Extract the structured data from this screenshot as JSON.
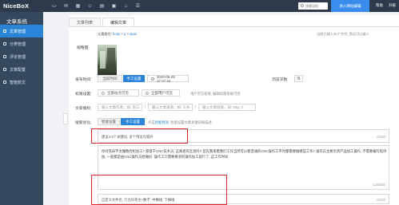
{
  "header": {
    "brand": "NiceBoX",
    "icons": [
      "monitor-icon",
      "chat-icon",
      "grid-icon",
      "user-icon",
      "document-icon",
      "window-icon",
      "home-icon",
      "list-icon"
    ],
    "quick_nav": "快捷导航",
    "editor_button": "进入网站编辑",
    "help": "帮助",
    "upgrade": "升级"
  },
  "sidebar": {
    "title": "文章系统",
    "items": [
      {
        "label": "文章管理",
        "active": true
      },
      {
        "label": "分类管理",
        "active": false
      },
      {
        "label": "评论管理",
        "active": false
      },
      {
        "label": "文章配置",
        "active": false
      },
      {
        "label": "智能软文",
        "active": false
      }
    ]
  },
  "tabs": [
    "文章列表",
    "编辑文章"
  ],
  "path": {
    "prefix": "元素路径: ",
    "body": "body",
    "sep1": " > ",
    "p": "p",
    "sep2": " > ",
    "span": "span",
    "hint": "当前已输入45个字符, 您还可以输入"
  },
  "form": {
    "thumb_label": "缩略图:",
    "publish_label": "发布时间:",
    "publish_current": "当前时间",
    "publish_manual": "手工设置",
    "publish_value": "2020-05-08 17:37:44",
    "browse_label": "浏览次数:",
    "browse_value": "9",
    "perm_label": "权限设置:",
    "perm_all": "全部站点可见",
    "perm_user": "全部用户可见",
    "perm_hint": "用户可见权限, 编辑权限系统可控",
    "source_label": "文章版权:",
    "source_author": "输入文章作者。如: 张三",
    "source_from": "输入文章来源。如: 头条",
    "source_link": "输入文章链接。如: http: //",
    "seo_label": "搜索优化:",
    "seo_smart": "智能设置",
    "seo_manual": "手工设置",
    "seo_hint_prefix": "点击",
    "seo_hint_link": "智能预测",
    "seo_hint_suffix": ", 智能设置文章关键词和描述"
  },
  "keywords": {
    "placeholder": "建议3-5个关键词, 多个用逗号隔开",
    "count": "0/100"
  },
  "description": {
    "text": "你对铣床不太懂数控机加工? 愿意干CNC技术员, 这两者有区别吗? 首先我来看我们工作当然可以看普通的CNC操作工平时都需要做哪些工作? 操作员主要负责产品加工操作, 不需要编写程序加, 一般都是由CNC操作员给做好, 操作工只需要要求的操作加工就行了, 这工作时间",
    "count": "125/300"
  },
  "filename": {
    "placeholder": "自定义文件名, 只允许英文+数字, 中横线, 下横线",
    "count": "0/100"
  },
  "colors": {
    "topbar": "#2d3a4b",
    "sidebar": "#34495e",
    "accent": "#2a84d8",
    "highlight_border": "#e0262c"
  }
}
